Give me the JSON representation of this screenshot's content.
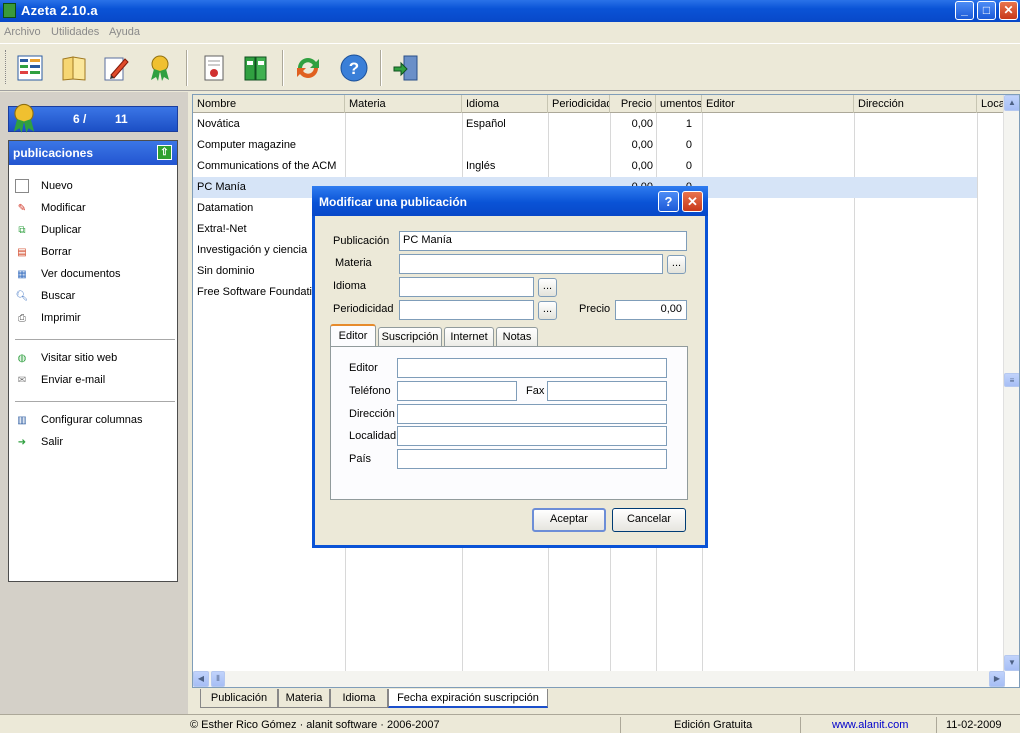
{
  "window": {
    "title": "Azeta 2.10.a",
    "buttons": {
      "minimize": "_",
      "maximize": "□",
      "close": "✕"
    }
  },
  "menu": [
    "Archivo",
    "Utilidades",
    "Ayuda"
  ],
  "toolbar": [
    {
      "icon": "list-view-icon"
    },
    {
      "icon": "book-icon"
    },
    {
      "icon": "edit-pencil-icon"
    },
    {
      "icon": "rosette-award-icon"
    },
    {
      "icon": "certificate-document-icon"
    },
    {
      "icon": "binders-icon"
    },
    {
      "icon": "refresh-arrows-icon"
    },
    {
      "icon": "help-icon"
    },
    {
      "icon": "exit-door-icon"
    }
  ],
  "counter": {
    "current": "6 /",
    "total": "11"
  },
  "side_panel": {
    "title": "publicaciones",
    "group1": [
      "Nuevo",
      "Modificar",
      "Duplicar",
      "Borrar",
      "Ver documentos",
      "Buscar",
      "Imprimir"
    ],
    "group2": [
      "Visitar sitio web",
      "Enviar e-mail"
    ],
    "group3": [
      "Configurar columnas",
      "Salir"
    ]
  },
  "grid": {
    "columns": [
      "Nombre",
      "Materia",
      "Idioma",
      "Periodicidad",
      "Precio",
      "umentos",
      "Editor",
      "Dirección",
      "Loca"
    ],
    "rows": [
      {
        "nombre": "Novática",
        "materia": "",
        "idioma": "Español",
        "periodicidad": "",
        "precio": "0,00",
        "documentos": "1"
      },
      {
        "nombre": "Computer magazine",
        "materia": "",
        "idioma": "",
        "periodicidad": "",
        "precio": "0,00",
        "documentos": "0"
      },
      {
        "nombre": "Communications of the ACM",
        "materia": "",
        "idioma": "Inglés",
        "periodicidad": "",
        "precio": "0,00",
        "documentos": "0"
      },
      {
        "nombre": "PC Manía",
        "materia": "",
        "idioma": "",
        "periodicidad": "",
        "precio": "0,00",
        "documentos": "0"
      },
      {
        "nombre": "Datamation",
        "materia": "",
        "idioma": "",
        "periodicidad": "",
        "precio": "",
        "documentos": ""
      },
      {
        "nombre": "Extra!-Net",
        "materia": "",
        "idioma": "",
        "periodicidad": "",
        "precio": "",
        "documentos": ""
      },
      {
        "nombre": "Investigación y ciencia",
        "materia": "",
        "idioma": "",
        "periodicidad": "",
        "precio": "",
        "documentos": ""
      },
      {
        "nombre": "Sin dominio",
        "materia": "",
        "idioma": "",
        "periodicidad": "",
        "precio": "",
        "documentos": ""
      },
      {
        "nombre": "Free Software Foundation",
        "materia": "",
        "idioma": "",
        "periodicidad": "",
        "precio": "",
        "documentos": ""
      }
    ]
  },
  "bottom_tabs": [
    "Publicación",
    "Materia",
    "Idioma",
    "Fecha expiración suscripción"
  ],
  "status": {
    "copyright": "© Esther Rico Gómez · alanit software · 2006-2007",
    "edition": "Edición Gratuita",
    "url": "www.alanit.com",
    "date": "11-02-2009"
  },
  "dialog": {
    "title": "Modificar una publicación",
    "help_label": "?",
    "close_label": "✕",
    "labels": {
      "publicacion": "Publicación",
      "materia": "Materia",
      "idioma": "Idioma",
      "periodicidad": "Periodicidad",
      "precio": "Precio"
    },
    "values": {
      "publicacion": "PC Manía",
      "materia": "",
      "idioma": "",
      "periodicidad": "",
      "precio": "0,00"
    },
    "browse_label": "...",
    "tabs": [
      "Editor",
      "Suscripción",
      "Internet",
      "Notas"
    ],
    "editor_labels": {
      "editor": "Editor",
      "telefono": "Teléfono",
      "fax": "Fax",
      "direccion": "Dirección",
      "localidad": "Localidad",
      "pais": "País"
    },
    "editor_values": {
      "editor": "",
      "telefono": "",
      "fax": "",
      "direccion": "",
      "localidad": "",
      "pais": ""
    },
    "ok_label": "Aceptar",
    "cancel_label": "Cancelar"
  },
  "colors": {
    "titlebar": "#0a53d6",
    "selected_row": "#d6e4f7",
    "panel_header": "#2355d0",
    "status_url": "#0000cc"
  }
}
